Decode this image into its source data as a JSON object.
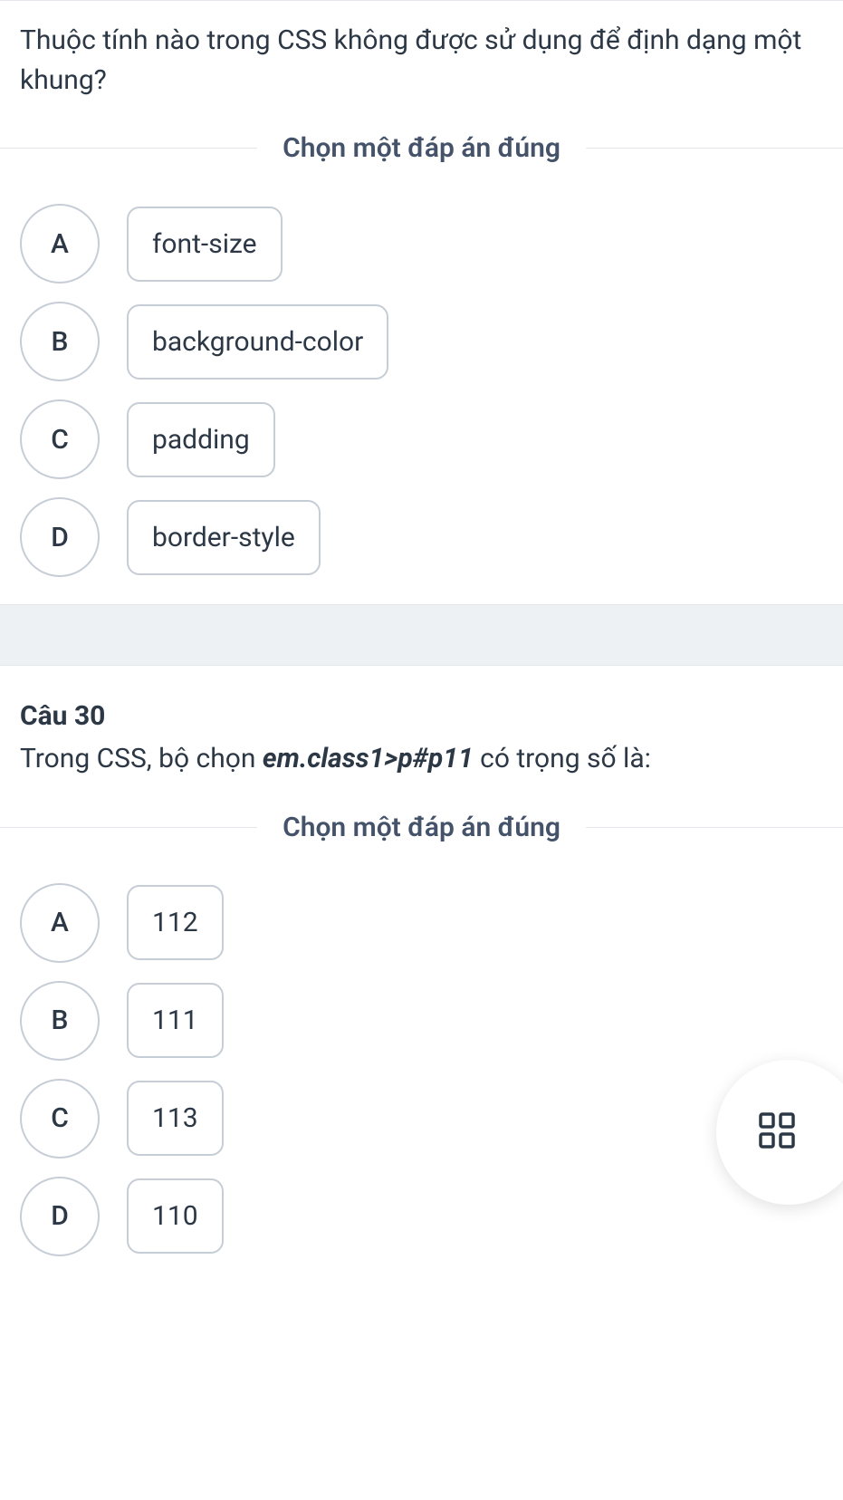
{
  "question29": {
    "text": "Thuộc tính nào trong CSS không được sử dụng để định dạng một khung?",
    "instruction": "Chọn một đáp án đúng",
    "options": [
      {
        "letter": "A",
        "label": "font-size"
      },
      {
        "letter": "B",
        "label": "background-color"
      },
      {
        "letter": "C",
        "label": "padding"
      },
      {
        "letter": "D",
        "label": "border-style"
      }
    ]
  },
  "question30": {
    "title": "Câu 30",
    "text_prefix": "Trong CSS, bộ chọn ",
    "text_em": "em.class1>p#p11",
    "text_suffix": " có trọng số là:",
    "instruction": "Chọn một đáp án đúng",
    "options": [
      {
        "letter": "A",
        "label": "112"
      },
      {
        "letter": "B",
        "label": "111"
      },
      {
        "letter": "C",
        "label": "113"
      },
      {
        "letter": "D",
        "label": "110"
      }
    ]
  }
}
